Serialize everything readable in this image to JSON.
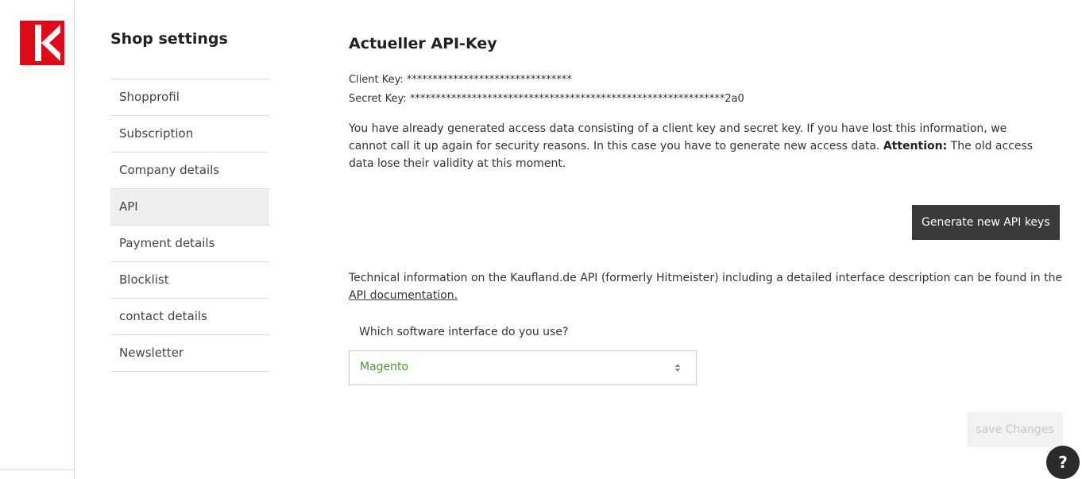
{
  "brand": {
    "logo_icon": "kaufland-logo-icon",
    "accent_color": "#e10915"
  },
  "sidebar": {
    "title": "Shop settings",
    "items": [
      {
        "label": "Shopprofil",
        "active": false
      },
      {
        "label": "Subscription",
        "active": false
      },
      {
        "label": "Company details",
        "active": false
      },
      {
        "label": "API",
        "active": true
      },
      {
        "label": "Payment details",
        "active": false
      },
      {
        "label": "Blocklist",
        "active": false
      },
      {
        "label": "contact details",
        "active": false
      },
      {
        "label": "Newsletter",
        "active": false
      }
    ]
  },
  "main": {
    "title": "Actueller API-Key",
    "client_key": "Client Key: ********************************",
    "secret_key": "Secret Key: *************************************************************2a0",
    "info_text_1": "You have already generated access data consisting of a client key and secret key. If you have lost this information, we cannot call it up again for security reasons. In this case you have to generate new access data. ",
    "info_attention": "Attention:",
    "info_text_2": " The old access data lose their validity at this moment.",
    "generate_button": "Generate new API keys",
    "tech_text": "Technical information on the Kaufland.de API (formerly Hitmeister) including a detailed interface description can be found in the ",
    "api_doc_link": "API documentation.",
    "select_label": "Which software interface do you use?",
    "select_value": "Magento",
    "select_value_color": "#4c9a2a",
    "save_button": "save Changes",
    "help_label": "?"
  }
}
